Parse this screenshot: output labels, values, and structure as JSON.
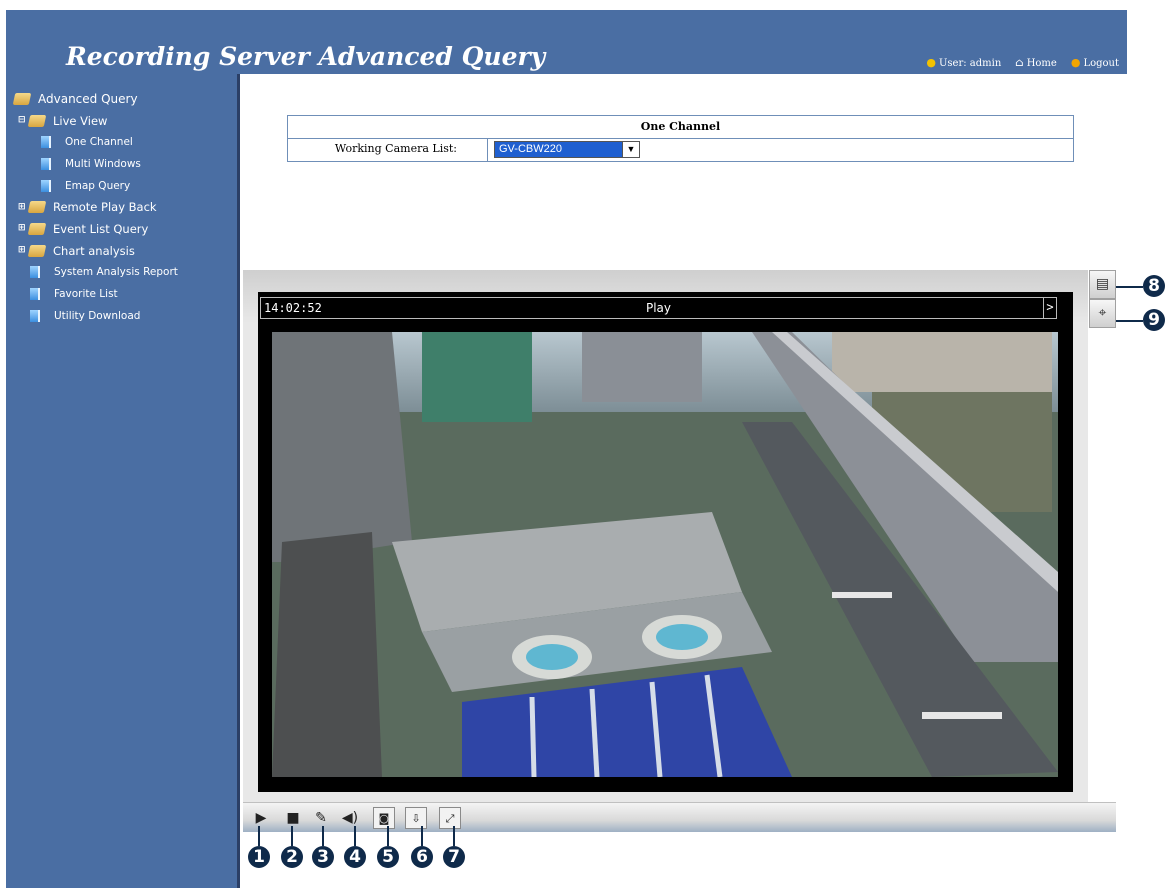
{
  "header": {
    "title": "Recording Server Advanced Query",
    "user_label": "User: admin",
    "home_label": "Home",
    "logout_label": "Logout"
  },
  "sidebar": {
    "root_label": "Advanced Query",
    "live_view": "Live View",
    "one_channel": "One Channel",
    "multi_windows": "Multi Windows",
    "emap_query": "Emap Query",
    "remote_play_back": "Remote Play Back",
    "event_list_query": "Event List Query",
    "chart_analysis": "Chart analysis",
    "system_analysis_report": "System Analysis Report",
    "favorite_list": "Favorite List",
    "utility_download": "Utility Download"
  },
  "panel": {
    "heading": "One Channel",
    "camera_list_label": "Working Camera List:",
    "camera_value": "GV-CBW220"
  },
  "viewer": {
    "time": "14:02:52",
    "status": "Play",
    "more": ">"
  },
  "callouts": [
    "1",
    "2",
    "3",
    "4",
    "5",
    "6",
    "7",
    "8",
    "9"
  ]
}
